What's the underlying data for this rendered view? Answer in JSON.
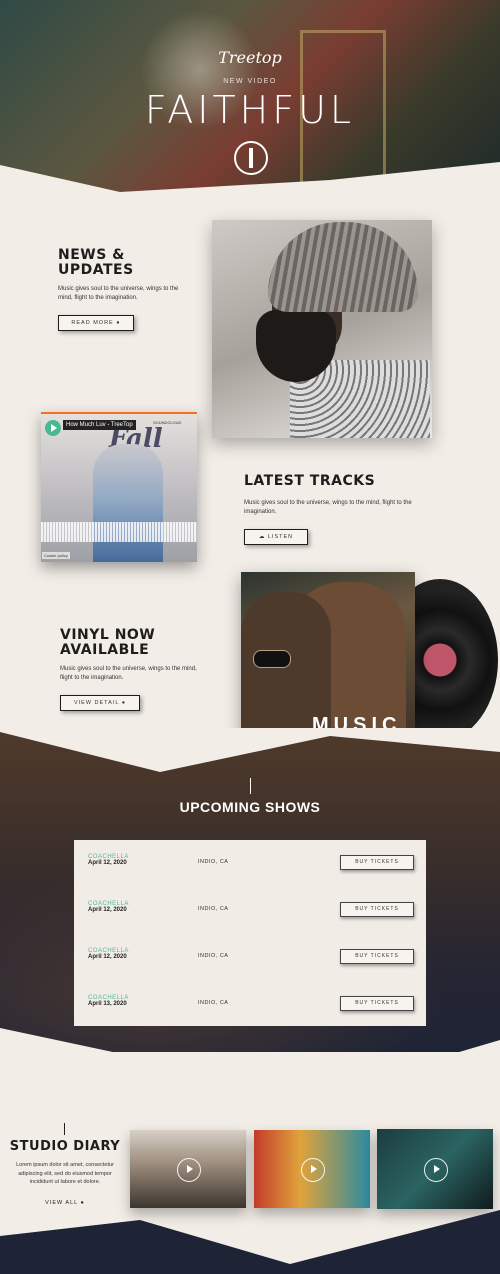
{
  "hero": {
    "brand": "Treetop",
    "kicker": "NEW VIDEO",
    "title": "FAITHFUL"
  },
  "news": {
    "heading_line1": "NEWS &",
    "heading_line2": "UPDATES",
    "text_line1": "Music gives soul to the universe, wings to the",
    "text_line2": "mind, flight to the imagination.",
    "button": "READ MORE"
  },
  "tracks": {
    "heading": "LATEST TRACKS",
    "text_line1": "Music gives soul to the universe, wings to the mind, flight to the",
    "text_line2": "imagination.",
    "button": "LISTEN",
    "player": {
      "track_title": "How Much Luv - TreeTop",
      "source": "SOUNDCLOUD",
      "cover_title": "Fall",
      "cookie": "Cookie policy"
    }
  },
  "vinyl": {
    "heading_line1": "VINYL NOW",
    "heading_line2": "AVAILABLE",
    "text_line1": "Music gives soul to the universe, wings to the mind,",
    "text_line2": "flight to the imagination.",
    "button": "VIEW DETAIL",
    "album_word": "MUSIC"
  },
  "shows": {
    "heading": "UPCOMING SHOWS",
    "rows": [
      {
        "name": "COACHELLA",
        "date": "April 12, 2020",
        "location": "INDIO, CA",
        "button": "BUY TICKETS"
      },
      {
        "name": "COACHELLA",
        "date": "April 12, 2020",
        "location": "INDIO, CA",
        "button": "BUY TICKETS"
      },
      {
        "name": "COACHELLA",
        "date": "April 12, 2020",
        "location": "INDIO, CA",
        "button": "BUY TICKETS"
      },
      {
        "name": "COACHELLA",
        "date": "April 13, 2020",
        "location": "INDIO, CA",
        "button": "BUY TICKETS"
      }
    ]
  },
  "diary": {
    "heading": "STUDIO DIARY",
    "text_line1": "Lorem ipsum dolor sit amet, consectetur",
    "text_line2": "adipiscing elit, sed do eiusmod tempor",
    "text_line3": "incididunt ut labore et dolore.",
    "button": "VIEW ALL"
  },
  "colors": {
    "accent": "#4fb99a",
    "dark": "#1e2436",
    "background": "#f2ede7"
  }
}
